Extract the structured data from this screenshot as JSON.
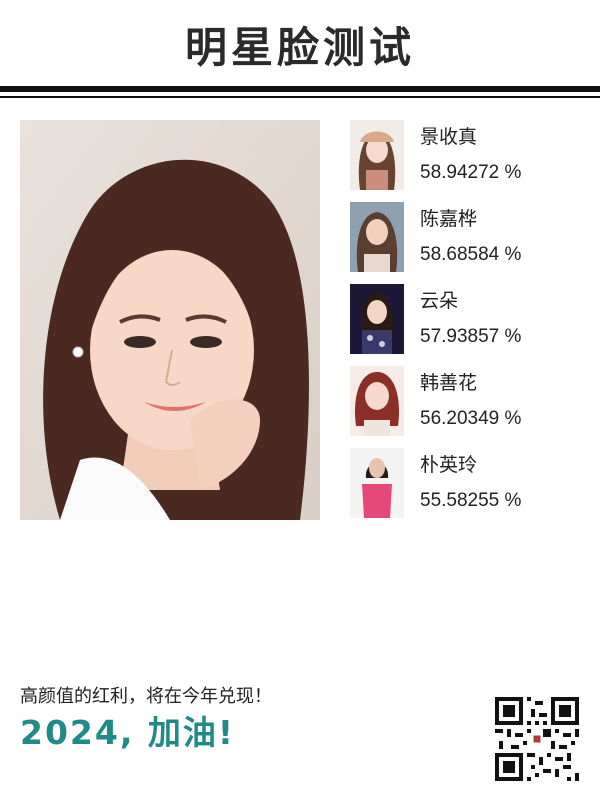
{
  "header": {
    "title": "明星脸测试"
  },
  "matches": [
    {
      "name": "景收真",
      "score": "58.94272 %",
      "accent": "#c98f7a"
    },
    {
      "name": "陈嘉桦",
      "score": "58.68584 %",
      "accent": "#8a6a5c"
    },
    {
      "name": "云朵",
      "score": "57.93857 %",
      "accent": "#2b2350"
    },
    {
      "name": "韩善花",
      "score": "56.20349 %",
      "accent": "#9a3a32"
    },
    {
      "name": "朴英玲",
      "score": "55.58255 %",
      "accent": "#e5497a"
    }
  ],
  "footer": {
    "tagline": "高颜值的红利，将在今年兑现！",
    "slogan": "2024, 加油!"
  },
  "colors": {
    "slogan": "#1f8a87",
    "rule": "#111111"
  }
}
